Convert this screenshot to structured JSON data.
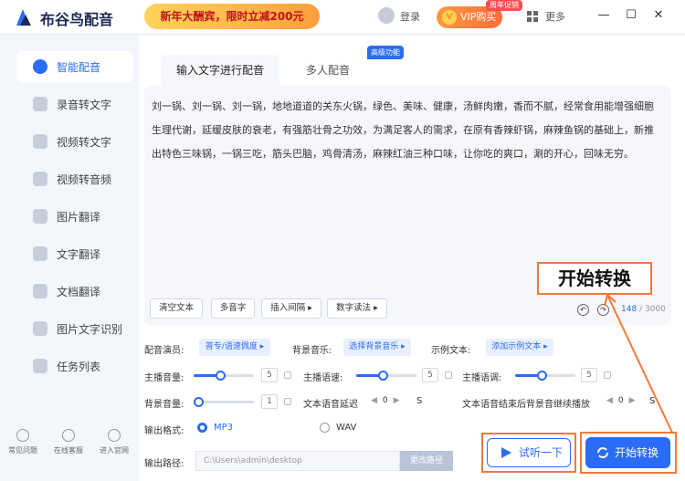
{
  "app": {
    "title": "布谷鸟配音",
    "promo": "新年大酬宾，限时立减200元",
    "login": "登录",
    "vip": "VIP购买",
    "vip_badge": "周年促销",
    "more": "更多"
  },
  "sidebar": {
    "items": [
      {
        "label": "智能配音",
        "icon": "smart-voice-icon"
      },
      {
        "label": "录音转文字",
        "icon": "recording-icon"
      },
      {
        "label": "视频转文字",
        "icon": "video-text-icon"
      },
      {
        "label": "视频转音频",
        "icon": "video-audio-icon"
      },
      {
        "label": "图片翻译",
        "icon": "image-translate-icon"
      },
      {
        "label": "文字翻译",
        "icon": "text-translate-icon"
      },
      {
        "label": "文档翻译",
        "icon": "doc-translate-icon"
      },
      {
        "label": "图片文字识别",
        "icon": "ocr-icon"
      },
      {
        "label": "任务列表",
        "icon": "task-list-icon"
      }
    ],
    "bottom": [
      "常见问题",
      "在线客服",
      "进入官网"
    ]
  },
  "tabs": {
    "input": "输入文字进行配音",
    "multi": "多人配音",
    "adv_badge": "高级功能"
  },
  "editor": {
    "text": "刘一锅、刘一锅、刘一锅，地地道道的关东火锅，绿色、美味、健康，汤鲜肉嫩，香而不腻，经常食用能增强细胞生理代谢，延缓皮肤的衰老，有强筋壮骨之功效，为满足客人的需求，在原有香辣虾锅，麻辣鱼锅的基础上，新推出特色三味锅，一锅三吃，筋头巴脑，鸡骨清汤，麻辣红油三种口味，让你吃的爽口，涮的开心，回味无穷。",
    "tools": [
      "清空文本",
      "多音字",
      "插入间隔 ▸",
      "数字读法 ▸"
    ],
    "count": "148",
    "max": " / 3000"
  },
  "settings": {
    "anchor_label": "配音演员:",
    "anchor_value": "普专/语速佩度 ▸",
    "bgm_label": "背景音乐:",
    "bgm_value": "选择背景音乐 ▸",
    "example_label": "示例文本:",
    "example_value": "添加示例文本 ▸",
    "volume_label": "主播音量:",
    "volume_value": "5",
    "speed_label": "主播语速:",
    "speed_value": "5",
    "pitch_label": "主播语调:",
    "pitch_value": "5",
    "bg_volume_label": "背景音量:",
    "bg_volume_value": "1",
    "delay_label": "文本语音延迟",
    "delay_value": "0",
    "delay_after_label": "文本语音结束后背景音继续播放",
    "delay_after_value": "0",
    "unit": "S",
    "format_label": "输出格式:",
    "format_mp3": "MP3",
    "format_wav": "WAV",
    "path_label": "输出路径:",
    "path_value": "C:\\Users\\admin\\desktop",
    "path_button": "更改路径"
  },
  "actions": {
    "trial": "试听一下",
    "start": "开始转换"
  },
  "callout": "开始转换",
  "colors": {
    "accent": "#2b6cf6",
    "highlight": "#ef7a3a"
  }
}
